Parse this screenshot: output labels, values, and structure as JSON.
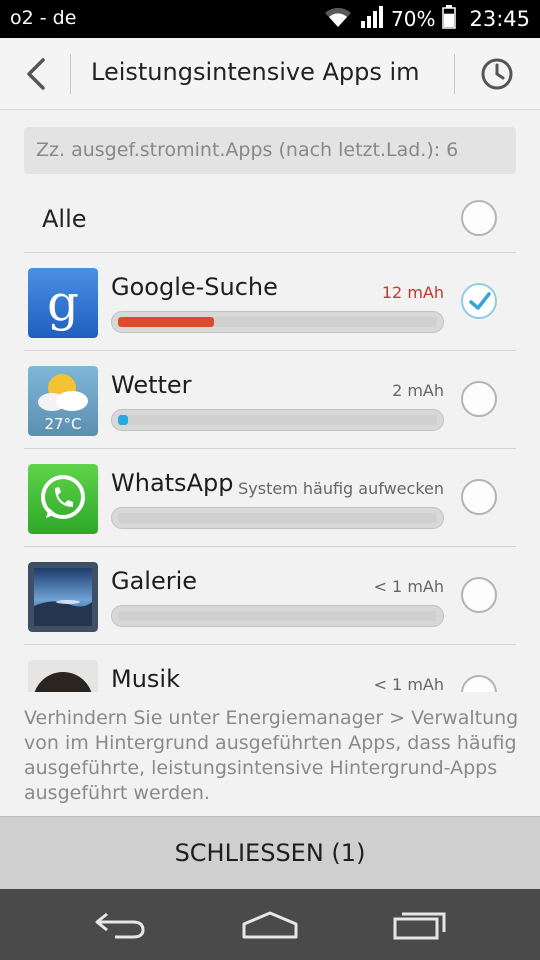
{
  "status": {
    "carrier": "o2 - de",
    "battery_pct": "70%",
    "battery_level": 0.7,
    "time": "23:45"
  },
  "header": {
    "title": "Leistungsintensive Apps im"
  },
  "info": "Zz. ausgef.stromint.Apps (nach letzt.Lad.): 6",
  "all": {
    "label": "Alle",
    "checked": false
  },
  "apps": [
    {
      "name": "Google-Suche",
      "value": "12 mAh",
      "bar_fraction": 0.3,
      "bar_color": "#dd4b2a",
      "checked": true,
      "icon": "google-search-icon"
    },
    {
      "name": "Wetter",
      "value": "2 mAh",
      "bar_fraction": 0.03,
      "bar_color": "#29a8e0",
      "checked": false,
      "icon": "weather-icon",
      "icon_text": "27°C"
    },
    {
      "name": "WhatsApp",
      "value": "System häufig aufwecken",
      "bar_fraction": 0,
      "bar_color": "#d0d0d0",
      "checked": false,
      "icon": "whatsapp-icon"
    },
    {
      "name": "Galerie",
      "value": "< 1 mAh",
      "bar_fraction": 0,
      "bar_color": "#d0d0d0",
      "checked": false,
      "icon": "gallery-icon"
    },
    {
      "name": "Musik",
      "value": "< 1 mAh",
      "bar_fraction": 0,
      "bar_color": "#d0d0d0",
      "checked": false,
      "icon": "music-icon"
    }
  ],
  "footer_note": "Verhindern Sie unter Energiemanager > Verwaltung von im Hintergrund ausgeführten Apps, dass häufig ausgeführte, leistungsintensive Hintergrund-Apps ausgeführt werden.",
  "close_button": "SCHLIESSEN (1)",
  "nav": {
    "back": "back-icon",
    "home": "home-icon",
    "recents": "recents-icon"
  }
}
